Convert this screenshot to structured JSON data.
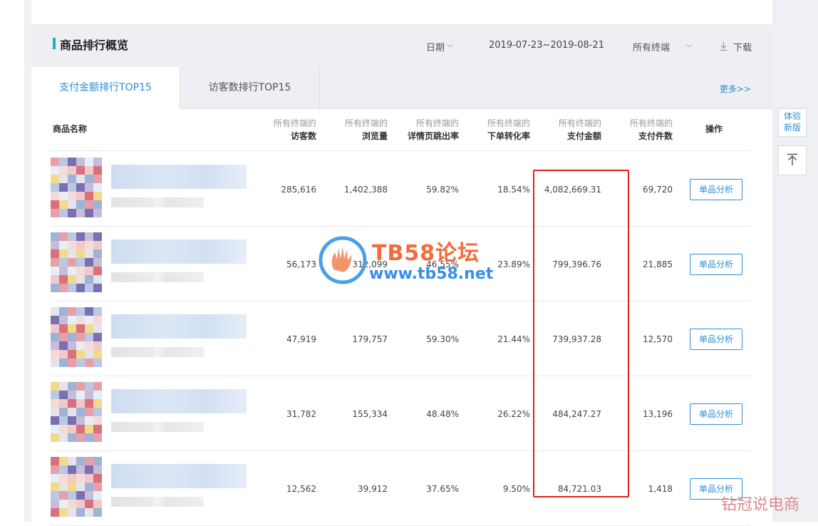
{
  "header": {
    "title": "商品排行概览",
    "date_label": "日期",
    "date_range": "2019-07-23~2019-08-21",
    "terminal_label": "所有终端",
    "download_label": "下载"
  },
  "tabs": [
    {
      "label": "支付金额排行TOP15"
    },
    {
      "label": "访客数排行TOP15"
    }
  ],
  "more_label": "更多>>",
  "columns": {
    "name": "商品名称",
    "visitors": {
      "sub": "所有终端的",
      "main": "访客数"
    },
    "pageviews": {
      "sub": "所有终端的",
      "main": "浏览量"
    },
    "bounce": {
      "sub": "所有终端的",
      "main": "详情页跳出率"
    },
    "conversion": {
      "sub": "所有终端的",
      "main": "下单转化率"
    },
    "payment": {
      "sub": "所有终端的",
      "main": "支付金额"
    },
    "items": {
      "sub": "所有终端的",
      "main": "支付件数"
    },
    "action": "操作"
  },
  "rows": [
    {
      "visitors": "285,616",
      "pageviews": "1,402,388",
      "bounce": "59.82%",
      "conversion": "18.54%",
      "payment": "4,082,669.31",
      "items": "69,720",
      "action": "单品分析"
    },
    {
      "visitors": "56,173",
      "pageviews": "312,099",
      "bounce": "46.55%",
      "conversion": "23.89%",
      "payment": "799,396.76",
      "items": "21,885",
      "action": "单品分析"
    },
    {
      "visitors": "47,919",
      "pageviews": "179,757",
      "bounce": "59.30%",
      "conversion": "21.44%",
      "payment": "739,937.28",
      "items": "12,570",
      "action": "单品分析"
    },
    {
      "visitors": "31,782",
      "pageviews": "155,334",
      "bounce": "48.48%",
      "conversion": "26.22%",
      "payment": "484,247.27",
      "items": "13,196",
      "action": "单品分析"
    },
    {
      "visitors": "12,562",
      "pageviews": "39,912",
      "bounce": "37.65%",
      "conversion": "9.50%",
      "payment": "84,721.03",
      "items": "1,418",
      "action": "单品分析"
    }
  ],
  "side": {
    "try_new_line1": "体验",
    "try_new_line2": "新版"
  },
  "watermark": {
    "title": "TB58论坛",
    "url": "www.tb58.net",
    "corner": "钻冠说电商"
  },
  "colors": {
    "accent": "#2e8ed6",
    "header_bar_accent": "#1ab0c8",
    "highlight_box": "#e02020"
  }
}
